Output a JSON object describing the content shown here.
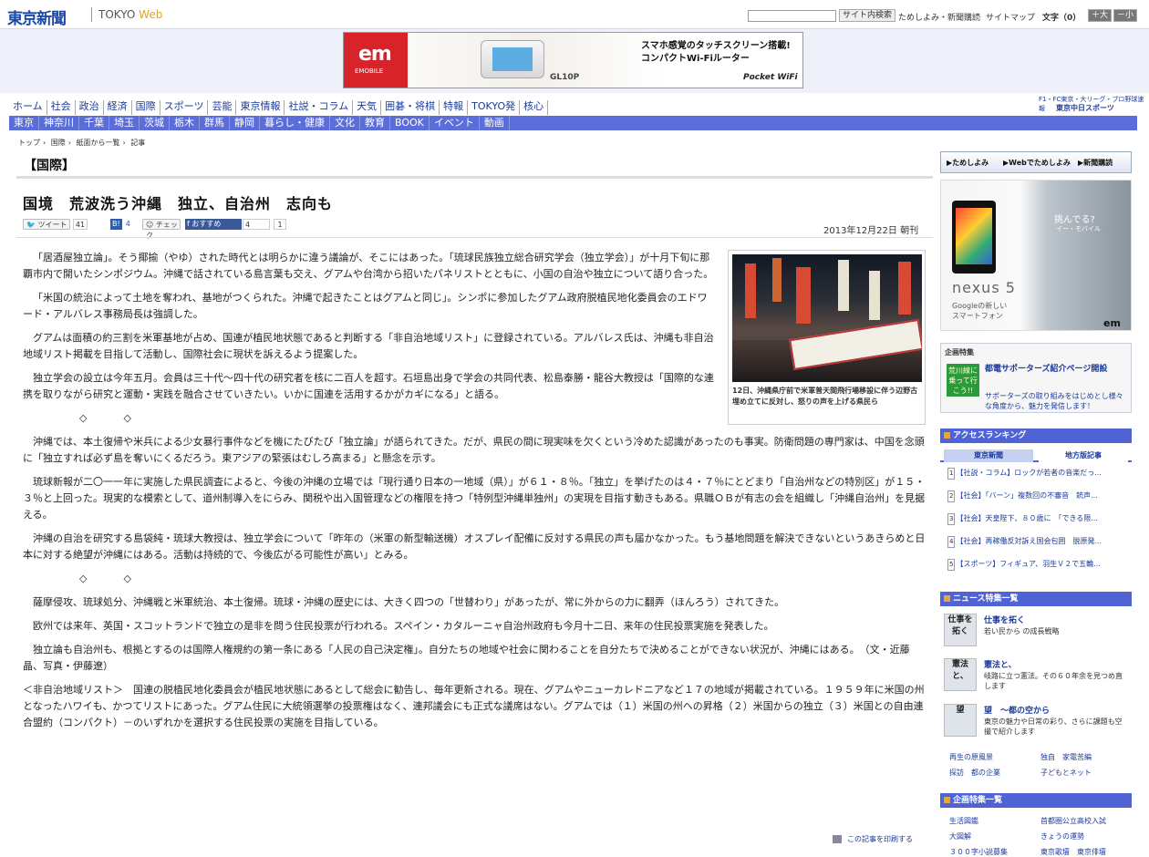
{
  "header": {
    "logo": "東京新聞",
    "logo_sub_1": "TOKYO",
    "logo_sub_2": "Web",
    "search_btn": "サイト内検索",
    "links": [
      "ためしよみ・新聞購読",
      "サイトマップ"
    ],
    "font_size_label": "文字（0）",
    "font_up": "＋大",
    "font_down": "－小"
  },
  "ad_top": {
    "brand": "em",
    "brand_sub": "EMOBILE",
    "model": "GL10P",
    "text_1": "スマホ感覚のタッチスクリーン搭載!",
    "text_2": "コンパクトWi-Fiルーター",
    "product": "Pocket WiFi"
  },
  "nav_primary": [
    "ホーム",
    "社会",
    "政治",
    "経済",
    "国際",
    "スポーツ",
    "芸能",
    "東京情報",
    "社説・コラム",
    "天気",
    "囲碁・将棋",
    "特報",
    "TOKYO発",
    "核心"
  ],
  "nav_secondary": [
    "東京",
    "神奈川",
    "千葉",
    "埼玉",
    "茨城",
    "栃木",
    "群馬",
    "静岡",
    "暮らし・健康",
    "文化",
    "教育",
    "BOOK",
    "イベント",
    "動画"
  ],
  "partner": {
    "f1": "F1・FC東京・大リーグ・プロ野球速報",
    "chunichi": "東京中日スポーツ"
  },
  "breadcrumb": [
    "トップ",
    "国際",
    "紙面から一覧",
    "記事"
  ],
  "section_title": "【国際】",
  "headline": "国境　荒波洗う沖縄　独立、自治州　志向も",
  "social": {
    "tweet": "ツイート",
    "tweet_count": "41",
    "hatena_count": "4",
    "mixi": "チェック",
    "fb": "おすすめ",
    "fb_count": "4",
    "one": "1"
  },
  "date": "2013年12月22日 朝刊",
  "photo_caption": "12日、沖縄県庁前で米軍普天間飛行場移設に伴う辺野古埋め立てに反対し、怒りの声を上げる県民ら",
  "paragraphs": [
    "「居酒屋独立論」。そう揶揄（やゆ）された時代とは明らかに違う議論が、そこにはあった。「琉球民族独立総合研究学会（独立学会）」が十月下旬に那覇市内で開いたシンポジウム。沖縄で話されている島言葉も交え、グアムや台湾から招いたパネリストとともに、小国の自治や独立について語り合った。",
    "「米国の統治によって土地を奪われ、基地がつくられた。沖縄で起きたことはグアムと同じ」。シンポに参加したグアム政府脱植民地化委員会のエドワード・アルバレス事務局長は強調した。",
    "グアムは面積の約三割を米軍基地が占め、国連が植民地状態であると判断する「非自治地域リスト」に登録されている。アルバレス氏は、沖縄も非自治地域リスト掲載を目指して活動し、国際社会に現状を訴えるよう提案した。",
    "独立学会の設立は今年五月。会員は三十代～四十代の研究者を核に二百人を超す。石垣島出身で学会の共同代表、松島泰勝・龍谷大教授は「国際的な連携を取りながら研究と運動・実践を融合させていきたい。いかに国連を活用するかがカギになる」と語る。",
    "◇◇",
    "沖縄では、本土復帰や米兵による少女暴行事件などを機にたびたび「独立論」が語られてきた。だが、県民の間に現実味を欠くという冷めた認識があったのも事実。防衛問題の専門家は、中国を念頭に「独立すれば必ず島を奪いにくるだろう。東アジアの緊張はむしろ高まる」と懸念を示す。",
    "琉球新報が二〇一一年に実施した県民調査によると、今後の沖縄の立場では「現行通り日本の一地域（県）」が６１・８％。「独立」を挙げたのは４・７％にとどまり「自治州などの特別区」が１５・３％と上回った。現実的な模索として、道州制導入をにらみ、関税や出入国管理などの権限を持つ「特例型沖縄単独州」の実現を目指す動きもある。県職ＯＢが有志の会を組織し「沖縄自治州」を見据える。",
    "沖縄の自治を研究する島袋純・琉球大教授は、独立学会について「昨年の（米軍の新型輸送機）オスプレイ配備に反対する県民の声も届かなかった。もう基地問題を解決できないというあきらめと日本に対する絶望が沖縄にはある。活動は持続的で、今後広がる可能性が高い」とみる。",
    "◇◇",
    "薩摩侵攻、琉球処分、沖縄戦と米軍統治、本土復帰。琉球・沖縄の歴史には、大きく四つの「世替わり」があったが、常に外からの力に翻弄（ほんろう）されてきた。",
    "欧州では来年、英国・スコットランドで独立の是非を問う住民投票が行われる。スペイン・カタルーニャ自治州政府も今月十二日、来年の住民投票実施を発表した。",
    "独立論も自治州も、根拠とするのは国際人権規約の第一条にある「人民の自己決定権」。自分たちの地域や社会に関わることを自分たちで決めることができない状況が、沖縄にはある。　（文・近藤晶、写真・伊藤遼）"
  ],
  "note": "＜非自治地域リスト＞　国連の脱植民地化委員会が植民地状態にあるとして総会に勧告し、毎年更新される。現在、グアムやニューカレドニアなど１７の地域が掲載されている。１９５９年に米国の州となったハワイも、かつてリストにあった。グアム住民に大統領選挙の投票権はなく、連邦議会にも正式な議席はない。グアムでは（１）米国の州への昇格（２）米国からの独立（３）米国との自由連合盟約（コンパクト）－のいずれかを選択する住民投票の実施を目指している。",
  "print_link": "この記事を印刷する",
  "sidebar": {
    "tabs": [
      "▶ためしよみ",
      "▶Webでためしよみ",
      "▶新聞購読"
    ],
    "nexus": {
      "q": "挑んでる?",
      "q2": "イー・モバイル",
      "brand": "nexus 5",
      "sub_1": "Googleの新しい",
      "sub_2": "スマートフォン",
      "em": "em"
    },
    "kikaku": {
      "head": "企画特集",
      "img": "荒川線に乗って行こう!!",
      "title": "都電サポーターズ紹介ページ開設",
      "desc": "サポーターズの取り組みをはじめとし様々な角度から、魅力を発信します！"
    },
    "ranking_title": "アクセスランキング",
    "ranking_tabs": [
      "東京新聞",
      "地方版記事"
    ],
    "ranking": [
      {
        "n": "1",
        "t": "【社説・コラム】ロックが若者の音楽だっ..."
      },
      {
        "n": "2",
        "t": "【社会】「バーン」複数回の不審音　銃声..."
      },
      {
        "n": "3",
        "t": "【社会】天皇陛下、８０歳に　「できる限..."
      },
      {
        "n": "4",
        "t": "【社会】再稼働反対訴え国会包囲　脱原発..."
      },
      {
        "n": "5",
        "t": "【スポーツ】フィギュア、羽生Ｖ２で五輪..."
      }
    ],
    "news_title": "ニュース特集一覧",
    "news": [
      {
        "img": "仕事を拓く",
        "title": "仕事を拓く",
        "desc": "若い民から の成長戦略"
      },
      {
        "img": "憲法と、",
        "title": "憲法と、",
        "desc": "岐路に立つ憲法。その６０年余を見つめ直します"
      },
      {
        "img": "望",
        "title": "望　～都の空から",
        "desc": "東京の魅力や日常の彩り、さらに課題も空撮で紹介します"
      }
    ],
    "news_links": [
      "再生の原風景",
      "独自　家電苦編",
      "探訪　都の企業",
      "子どもとネット"
    ],
    "kikaku2_title": "企画特集一覧",
    "kikaku2_links": [
      "生活図鑑",
      "首都圏公立高校入試",
      "大図解",
      "きょうの運勢",
      "３００字小説募集",
      "東京歌壇　東京俳壇"
    ]
  }
}
